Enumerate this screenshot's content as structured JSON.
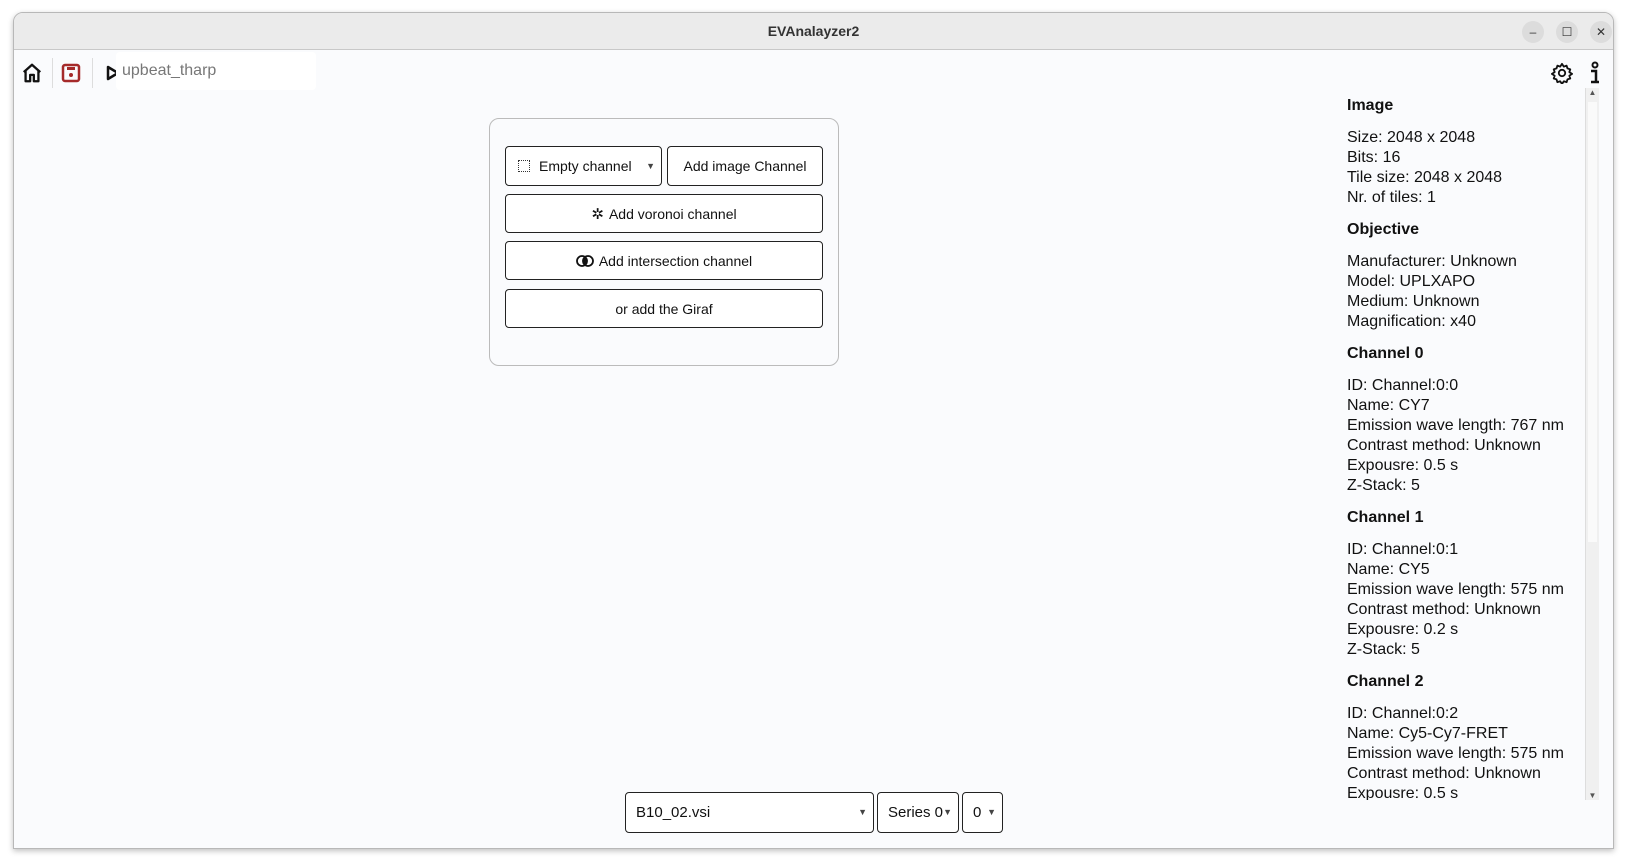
{
  "window": {
    "title": "EVAnalayzer2",
    "minimize": "–",
    "maximize": "☐",
    "close": "✕"
  },
  "toolbar": {
    "project_name": "upbeat_tharp"
  },
  "dialog": {
    "empty_channel": "Empty channel",
    "add_image_channel": "Add image Channel",
    "add_voronoi_channel": "Add voronoi channel",
    "add_intersection_channel": "Add intersection channel",
    "add_giraf": "or add the Giraf"
  },
  "info": {
    "sections": [
      {
        "title": "Image",
        "lines": [
          "Size: 2048 x 2048",
          "Bits: 16",
          "Tile size: 2048 x 2048",
          "Nr. of tiles: 1"
        ]
      },
      {
        "title": "Objective",
        "lines": [
          "Manufacturer: Unknown",
          "Model: UPLXAPO",
          "Medium: Unknown",
          "Magnification: x40"
        ]
      },
      {
        "title": "Channel 0",
        "lines": [
          "ID: Channel:0:0",
          "Name: CY7",
          "Emission wave length: 767 nm",
          "Contrast method: Unknown",
          "Expousre: 0.5 s",
          "Z-Stack: 5"
        ]
      },
      {
        "title": "Channel 1",
        "lines": [
          "ID: Channel:0:1",
          "Name: CY5",
          "Emission wave length: 575 nm",
          "Contrast method: Unknown",
          "Expousre: 0.2 s",
          "Z-Stack: 5"
        ]
      },
      {
        "title": "Channel 2",
        "lines": [
          "ID: Channel:0:2",
          "Name: Cy5-Cy7-FRET",
          "Emission wave length: 575 nm",
          "Contrast method: Unknown",
          "Expousre: 0.5 s"
        ]
      }
    ]
  },
  "footer": {
    "file": "B10_02.vsi",
    "series": "Series 0",
    "index": "0"
  },
  "colors": {
    "save_icon": "#a52a2a"
  }
}
